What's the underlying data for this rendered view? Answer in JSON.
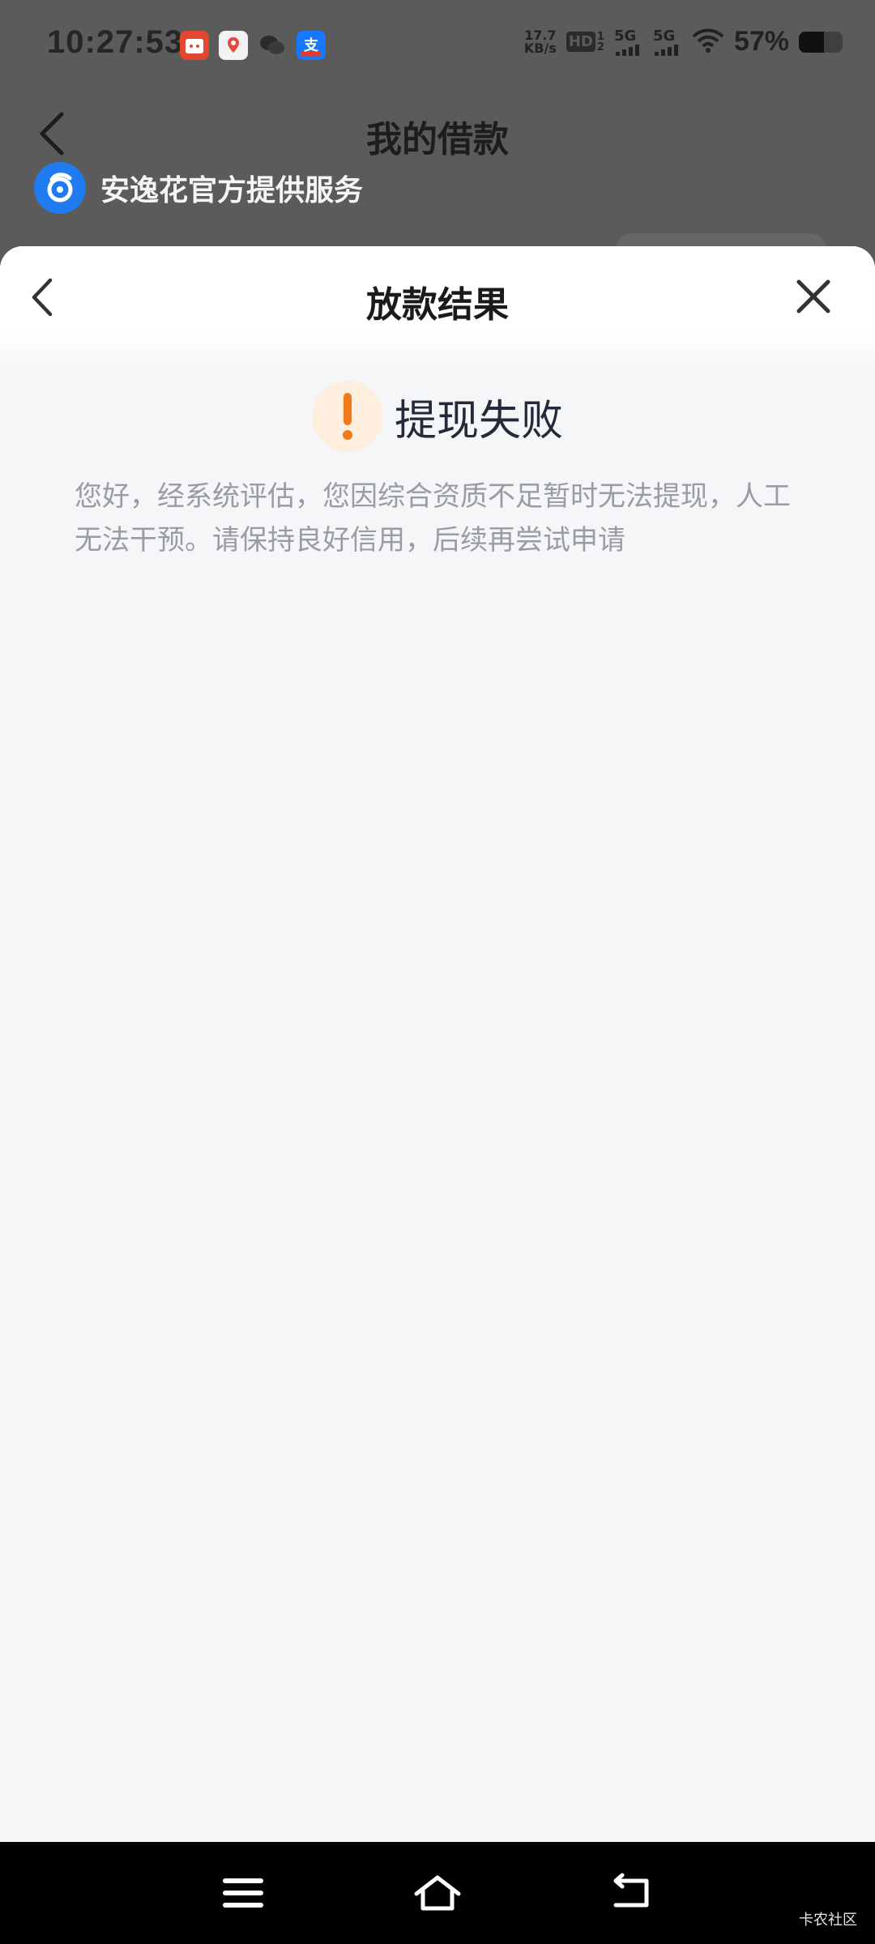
{
  "status_bar": {
    "time": "10:27:53",
    "net_speed_value": "17.7",
    "net_speed_unit": "KB/s",
    "hd_label": "HD",
    "sim_top": "1",
    "sim_bottom": "2",
    "signal1_label": "5G",
    "signal2_label": "5G",
    "battery_percent": "57%",
    "battery_level": 0.57
  },
  "background_page": {
    "title": "我的借款",
    "provider_text": "安逸花官方提供服务"
  },
  "sheet": {
    "title": "放款结果",
    "result_title": "提现失败",
    "result_message": "您好，经系统评估，您因综合资质不足暂时无法提现，人工无法干预。请保持良好信用，后续再尝试申请"
  },
  "app_icons": [
    "calendar-app-icon",
    "maps-app-icon",
    "wechat-icon",
    "alipay-icon"
  ],
  "colors": {
    "warning": "#f07a1a",
    "warning_bg": "#fdeede",
    "provider_blue": "#1e7bf0"
  },
  "watermark": "卡农社区"
}
